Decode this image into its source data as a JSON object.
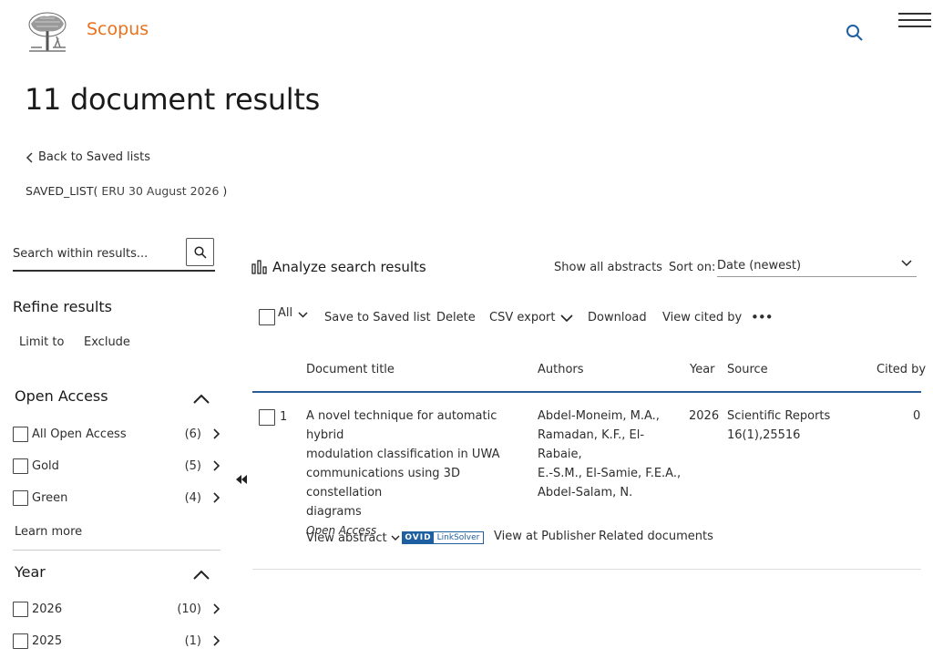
{
  "header": {
    "brand": "Scopus",
    "logo_icon": "elsevier-tree-logo",
    "search_icon": "search-icon",
    "menu_icon": "hamburger-menu-icon",
    "brand_color": "#e9711c",
    "accent_color": "#2a5c9a"
  },
  "page": {
    "title": "11 document results",
    "back_link": "Back to Saved lists",
    "saved_list_prefix": "SAVED_LIST(",
    "saved_list_name": " ERU 30 August 2026 ",
    "saved_list_suffix": ")"
  },
  "sidebar": {
    "search_placeholder": "Search within results...",
    "refine_title": "Refine results",
    "limit_label": "Limit to",
    "exclude_label": "Exclude",
    "open_access": {
      "title": "Open Access",
      "items": [
        {
          "label": "All Open Access",
          "count": "(6)"
        },
        {
          "label": "Gold",
          "count": "(5)"
        },
        {
          "label": "Green",
          "count": "(4)"
        }
      ],
      "learn_more": "Learn more"
    },
    "year": {
      "title": "Year",
      "items": [
        {
          "label": "2026",
          "count": "(10)"
        },
        {
          "label": "2025",
          "count": "(1)"
        }
      ]
    }
  },
  "main": {
    "analyze": "Analyze search results",
    "show_abstracts": "Show all abstracts",
    "sort_label": "Sort on:",
    "sort_value": "Date (newest)",
    "toolbar": {
      "all": "All",
      "save": "Save to Saved list",
      "delete": "Delete",
      "csv": "CSV export",
      "download": "Download",
      "cited": "View cited by",
      "more": "•••"
    },
    "columns": {
      "title": "Document title",
      "authors": "Authors",
      "year": "Year",
      "source": "Source",
      "cited": "Cited by"
    },
    "rows": [
      {
        "num": "1",
        "title_lines": [
          "A novel technique for automatic hybrid",
          "modulation classification in UWA",
          "communications using 3D constellation",
          "diagrams"
        ],
        "access": "Open Access",
        "author_lines": [
          "Abdel-Moneim, M.A.,",
          "Ramadan, K.F., El-Rabaie,",
          "E.-S.M., El-Samie, F.E.A.,",
          "Abdel-Salam, N."
        ],
        "year": "2026",
        "source_lines": [
          "Scientific Reports",
          "16(1),25516"
        ],
        "cited": "0",
        "view_abstract": "View abstract",
        "linksolver_ovid": "OVID",
        "linksolver_text": "LinkSolver",
        "view_publisher": "View at Publisher",
        "related": "Related documents"
      }
    ]
  }
}
